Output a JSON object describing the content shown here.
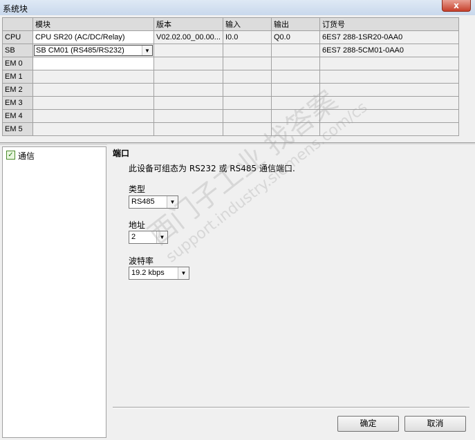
{
  "window": {
    "title": "系统块",
    "close_label": "x"
  },
  "grid": {
    "headers": [
      "",
      "模块",
      "版本",
      "输入",
      "输出",
      "订货号"
    ],
    "rows": [
      {
        "slot": "CPU",
        "module": "CPU SR20 (AC/DC/Relay)",
        "version": "V02.02.00_00.00...",
        "input": "I0.0",
        "output": "Q0.0",
        "order": "6ES7 288-1SR20-0AA0"
      },
      {
        "slot": "SB",
        "module": "SB CM01 (RS485/RS232)",
        "version": "",
        "input": "",
        "output": "",
        "order": "6ES7 288-5CM01-0AA0"
      },
      {
        "slot": "EM 0",
        "module": "",
        "version": "",
        "input": "",
        "output": "",
        "order": ""
      },
      {
        "slot": "EM 1",
        "module": "",
        "version": "",
        "input": "",
        "output": "",
        "order": ""
      },
      {
        "slot": "EM 2",
        "module": "",
        "version": "",
        "input": "",
        "output": "",
        "order": ""
      },
      {
        "slot": "EM 3",
        "module": "",
        "version": "",
        "input": "",
        "output": "",
        "order": ""
      },
      {
        "slot": "EM 4",
        "module": "",
        "version": "",
        "input": "",
        "output": "",
        "order": ""
      },
      {
        "slot": "EM 5",
        "module": "",
        "version": "",
        "input": "",
        "output": "",
        "order": ""
      }
    ]
  },
  "tree": {
    "items": [
      {
        "label": "通信",
        "checked": true
      }
    ]
  },
  "panel": {
    "section_title": "端口",
    "description": "此设备可组态为 RS232 或 RS485 通信端口.",
    "type": {
      "label": "类型",
      "value": "RS485"
    },
    "address": {
      "label": "地址",
      "value": "2"
    },
    "baud": {
      "label": "波特率",
      "value": "19.2 kbps"
    }
  },
  "buttons": {
    "ok": "确定",
    "cancel": "取消"
  },
  "watermark": {
    "line1": "西门子工业  找答案",
    "line2": "support.industry.siemens.com/cs"
  },
  "icons": {
    "dropdown": "chevron-down-icon",
    "check": "check-icon",
    "close": "close-icon"
  }
}
